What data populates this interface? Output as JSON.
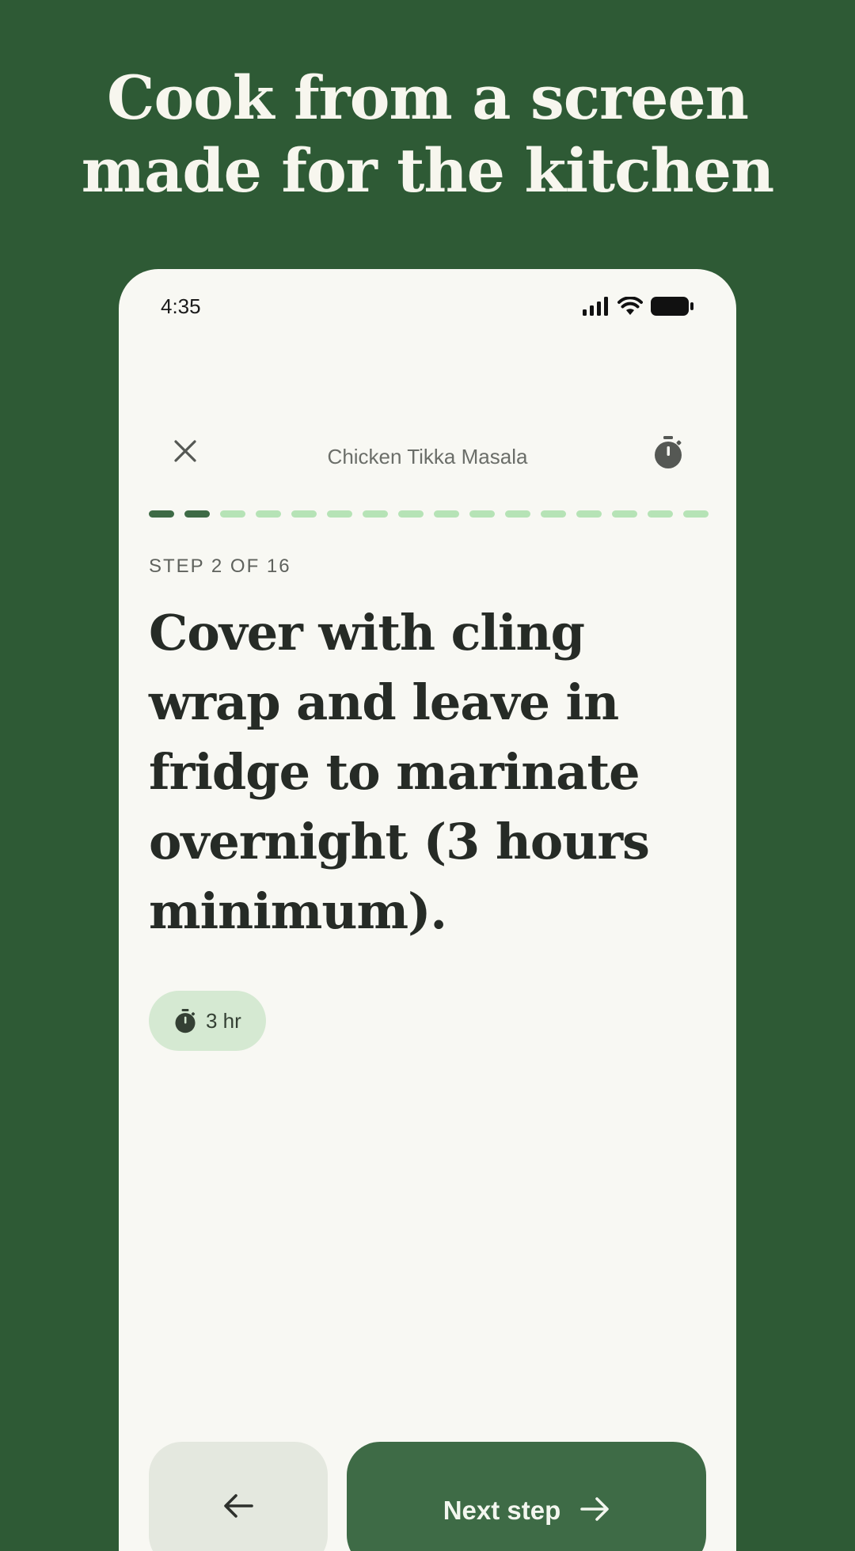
{
  "headline": {
    "line1": "Cook from a screen",
    "line2": "made for the kitchen"
  },
  "status_bar": {
    "time": "4:35",
    "icons": [
      "signal-icon",
      "wifi-icon",
      "battery-icon"
    ]
  },
  "cooking_mode": {
    "recipe_title": "Chicken Tikka Masala",
    "close_icon": "close-icon",
    "timer_icon": "stopwatch-icon",
    "progress": {
      "current_step": 2,
      "total_steps": 16
    },
    "step_label": "STEP 2 OF 16",
    "step_text": "Cover with cling wrap and leave in fridge to marinate overnight (3 hours minimum).",
    "timer_chip": {
      "label": "3 hr",
      "icon": "stopwatch-icon"
    },
    "back_button_icon": "arrow-left-icon",
    "next_button": {
      "label": "Next step",
      "icon": "arrow-right-icon"
    }
  },
  "colors": {
    "background": "#2e5a35",
    "screen": "#f8f8f3",
    "primary": "#3e6b46",
    "progress_inactive": "#b6e3b6",
    "chip": "#d5e9d2",
    "back_button": "#e4e8df"
  }
}
